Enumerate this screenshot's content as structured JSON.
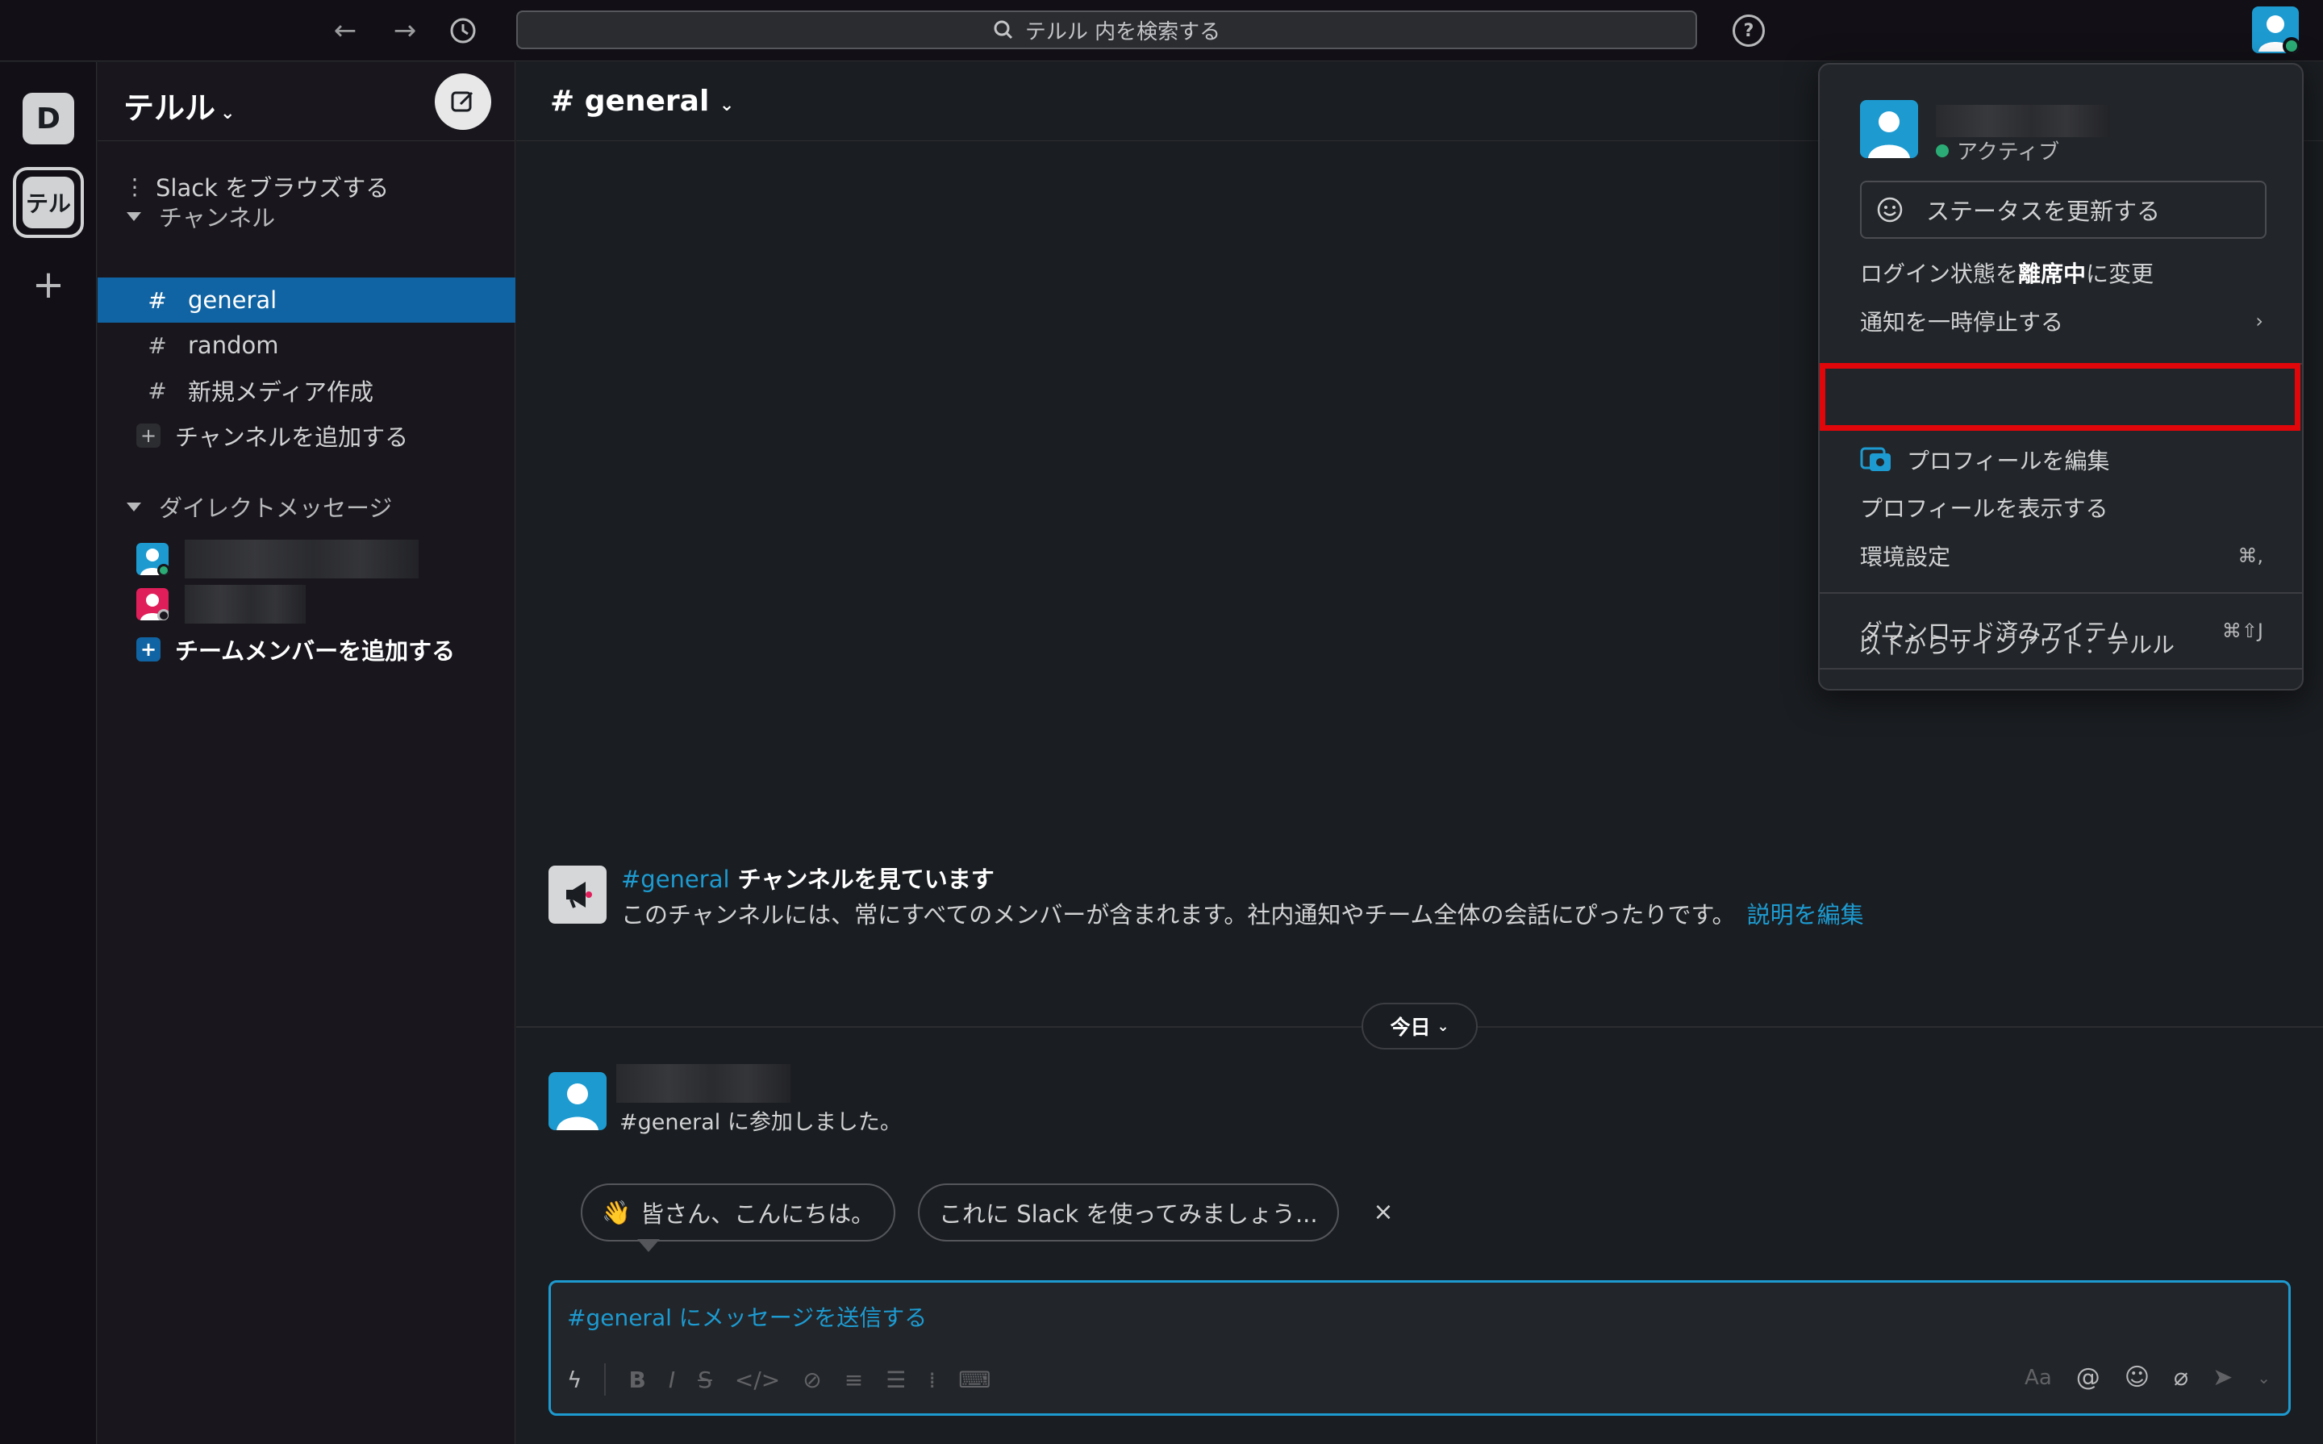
{
  "topbar": {
    "search_placeholder": "テルル 内を検索する",
    "help_label": "?"
  },
  "workspace_rail": {
    "workspaces": [
      {
        "label": "D"
      },
      {
        "label": "テル"
      }
    ],
    "add_label": "+"
  },
  "sidebar": {
    "workspace_name": "テルル",
    "browse_label": "Slack をブラウズする",
    "channels_header": "チャンネル",
    "channels": [
      {
        "label": "general",
        "active": true
      },
      {
        "label": "random",
        "active": false
      },
      {
        "label": "新規メディア作成",
        "active": false
      }
    ],
    "add_channel_label": "チャンネルを追加する",
    "dm_header": "ダイレクトメッセージ",
    "add_member_label": "チームメンバーを追加する"
  },
  "channel": {
    "title": "# general",
    "intro_link": "#general",
    "intro_title": "チャンネルを見ています",
    "intro_desc": "このチャンネルには、常にすべてのメンバーが含まれます。社内通知やチーム全体の会話にぴったりです。",
    "intro_edit_link": "説明を編集",
    "date_divider": "今日",
    "message_text": "#general に参加しました。",
    "chips": [
      {
        "emoji": "👋",
        "label": "皆さん、こんにちは。"
      },
      {
        "emoji": "",
        "label": "これに Slack を使ってみましょう..."
      }
    ],
    "chips_close": "×",
    "composer_placeholder": "#general にメッセージを送信する"
  },
  "profile_menu": {
    "status_active": "アクティブ",
    "update_status": "ステータスを更新する",
    "set_away_prefix": "ログイン状態を",
    "set_away_bold": "離席中",
    "set_away_suffix": "に変更",
    "pause_notifications": "通知を一時停止する",
    "pause_chevron": "›",
    "edit_profile": "プロフィールを編集",
    "view_profile": "プロフィールを表示する",
    "preferences": "環境設定",
    "preferences_shortcut": "⌘,",
    "downloads": "ダウンロード済みアイテム",
    "downloads_shortcut": "⌘⇧J",
    "sign_out": "以下からサインアウト：テルル"
  },
  "colors": {
    "accent": "#1d9bd1",
    "active_item": "#1164a3",
    "highlight_border": "#e0060a",
    "online": "#2bac76"
  }
}
